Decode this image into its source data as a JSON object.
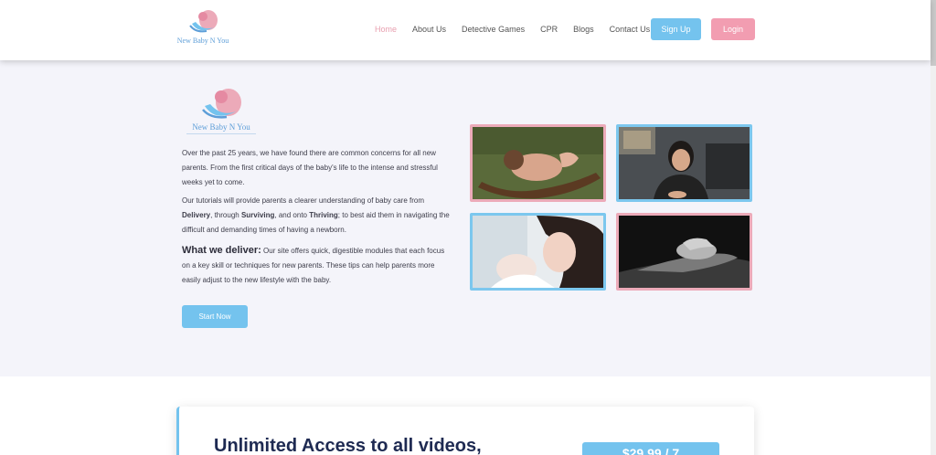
{
  "brand": {
    "logo_text": "New Baby N You"
  },
  "nav": {
    "items": [
      {
        "label": "Home",
        "active": true
      },
      {
        "label": "About Us"
      },
      {
        "label": "Detective Games"
      },
      {
        "label": "CPR"
      },
      {
        "label": "Blogs"
      },
      {
        "label": "Contact Us"
      }
    ],
    "signup_label": "Sign Up",
    "login_label": "Login"
  },
  "hero": {
    "paragraph1": "Over the past 25 years, we have found there are common concerns for all new parents. From the first critical days of the baby's life to the intense and stressful weeks yet to come.",
    "paragraph2": {
      "before": "Our tutorials will provide parents a clearer understanding of baby care from ",
      "delivery": "Delivery",
      "through": ", through ",
      "surviving": "Surviving",
      "onto": ", and onto ",
      "thriving": "Thriving",
      "after": "; to best aid them in navigating the difficult and demanding times of having a newborn."
    },
    "deliver_heading": "What we deliver:",
    "deliver_text": " Our site offers quick, digestible modules that each focus on a key skill or techniques for new parents. These tips can help parents more easily adjust to the new lifestyle with the baby.",
    "start_button": "Start Now"
  },
  "pricing": {
    "title": "Unlimited Access to all videos,",
    "button_label": "$29.99 / 7"
  },
  "colors": {
    "accent_blue": "#74c3ee",
    "accent_pink": "#f29db1",
    "heading_navy": "#1e2a52"
  }
}
